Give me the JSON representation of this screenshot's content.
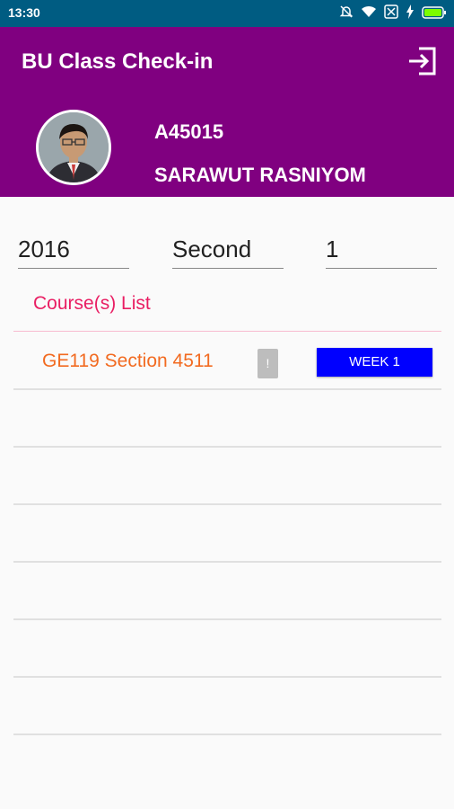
{
  "status_bar": {
    "time": "13:30"
  },
  "header": {
    "title": "BU Class Check-in",
    "student_id": "A45015",
    "student_name": "SARAWUT RASNIYOM",
    "color": "#800080"
  },
  "filters": {
    "year": "2016",
    "semester": "Second",
    "term": "1"
  },
  "courses": {
    "label": "Course(s) List",
    "items": [
      {
        "name": "GE119 Section 4511",
        "info_label": "!",
        "week_label": "WEEK 1"
      }
    ]
  },
  "icons": {
    "logout": "logout-icon",
    "wifi": "wifi-icon",
    "battery": "battery-icon",
    "mute": "mute-icon",
    "close": "close-icon",
    "charge": "charge-icon"
  }
}
